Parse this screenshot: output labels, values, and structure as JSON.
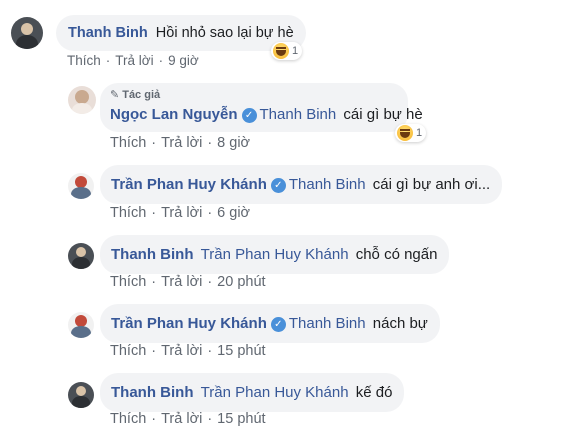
{
  "comments": [
    {
      "author": "Thanh Binh",
      "text": "Hồi nhỏ sao lại bự hè",
      "like": "Thích",
      "reply": "Trả lời",
      "time": "9 giờ",
      "reaction_count": "1"
    },
    {
      "badge": "Tác giả",
      "author": "Ngọc Lan Nguyễn",
      "tag": "Thanh Binh",
      "text": "cái gì bự hè",
      "like": "Thích",
      "reply": "Trả lời",
      "time": "8 giờ",
      "reaction_count": "1"
    },
    {
      "author": "Trần Phan Huy Khánh",
      "tag": "Thanh Binh",
      "text": "cái gì bự anh ơi...",
      "like": "Thích",
      "reply": "Trả lời",
      "time": "6 giờ"
    },
    {
      "author": "Thanh Binh",
      "tag": "Trần Phan Huy Khánh",
      "text": "chỗ có ngấn",
      "like": "Thích",
      "reply": "Trả lời",
      "time": "20 phút"
    },
    {
      "author": "Trần Phan Huy Khánh",
      "tag": "Thanh Binh",
      "text": "nách bự",
      "like": "Thích",
      "reply": "Trả lời",
      "time": "15 phút"
    },
    {
      "author": "Thanh Binh",
      "tag": "Trần Phan Huy Khánh",
      "text": "kế đó",
      "like": "Thích",
      "reply": "Trả lời",
      "time": "15 phút"
    }
  ],
  "separator": "·",
  "colors": {
    "link": "#385898",
    "bubble": "#f2f3f5",
    "meta": "#606770"
  }
}
